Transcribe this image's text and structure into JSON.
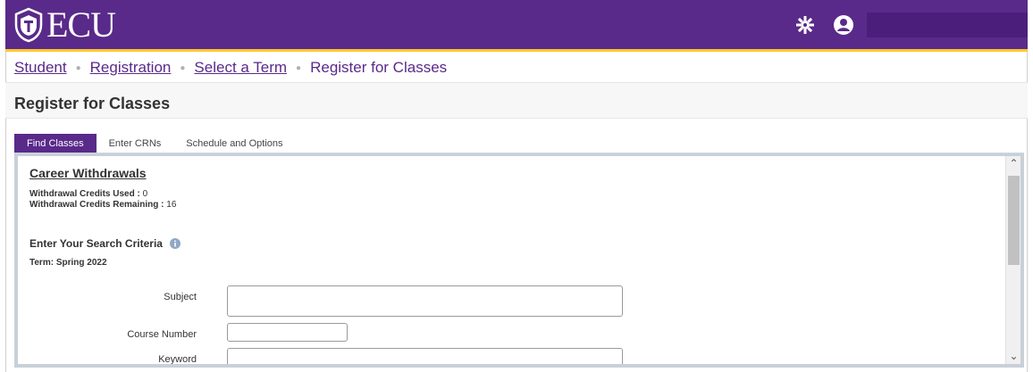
{
  "header": {
    "logo_text": "ECU",
    "brand_color": "#592a8a",
    "accent_color": "#fdc82f",
    "icons": [
      "seal-icon",
      "gear-icon",
      "user-icon"
    ]
  },
  "breadcrumb": {
    "items": [
      "Student",
      "Registration",
      "Select a Term"
    ],
    "current": "Register for Classes"
  },
  "page": {
    "title": "Register for Classes"
  },
  "tabs": [
    {
      "label": "Find Classes",
      "active": true
    },
    {
      "label": "Enter CRNs",
      "active": false
    },
    {
      "label": "Schedule and Options",
      "active": false
    }
  ],
  "withdrawals": {
    "heading": "Career Withdrawals",
    "used_label": "Withdrawal Credits Used :",
    "used_value": "0",
    "remaining_label": "Withdrawal Credits Remaining :",
    "remaining_value": "16"
  },
  "search": {
    "heading": "Enter Your Search Criteria",
    "term": "Term: Spring 2022",
    "fields": [
      {
        "label": "Subject",
        "value": ""
      },
      {
        "label": "Course Number",
        "value": ""
      },
      {
        "label": "Keyword",
        "value": ""
      }
    ]
  }
}
